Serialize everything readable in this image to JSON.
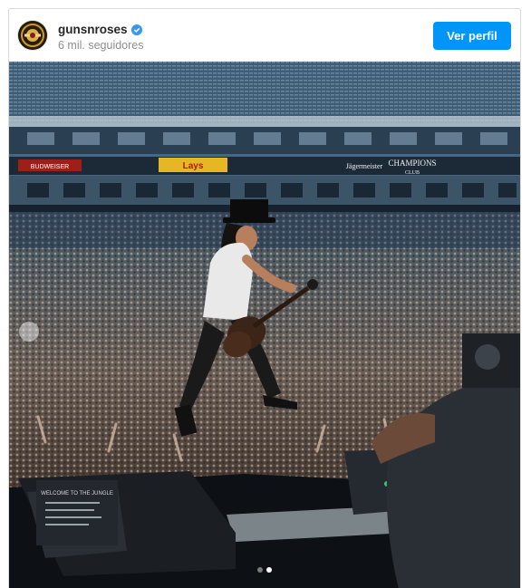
{
  "post": {
    "username": "gunsnroses",
    "followers": "6 mil. seguidores",
    "view_profile_label": "Ver perfil",
    "verified_icon": "verified-badge-icon",
    "accent": "#0095f6"
  },
  "photo": {
    "banner_left": "BUDWEISER",
    "banner_center": "Lays",
    "club_sign_1": "Jägermeister",
    "club_sign_2": "CHAMPIONS",
    "club_sign_3": "CLUB",
    "monitor_sign": "WELCOME TO THE JUNGLE"
  },
  "carousel": {
    "count": 2,
    "active": 2
  }
}
